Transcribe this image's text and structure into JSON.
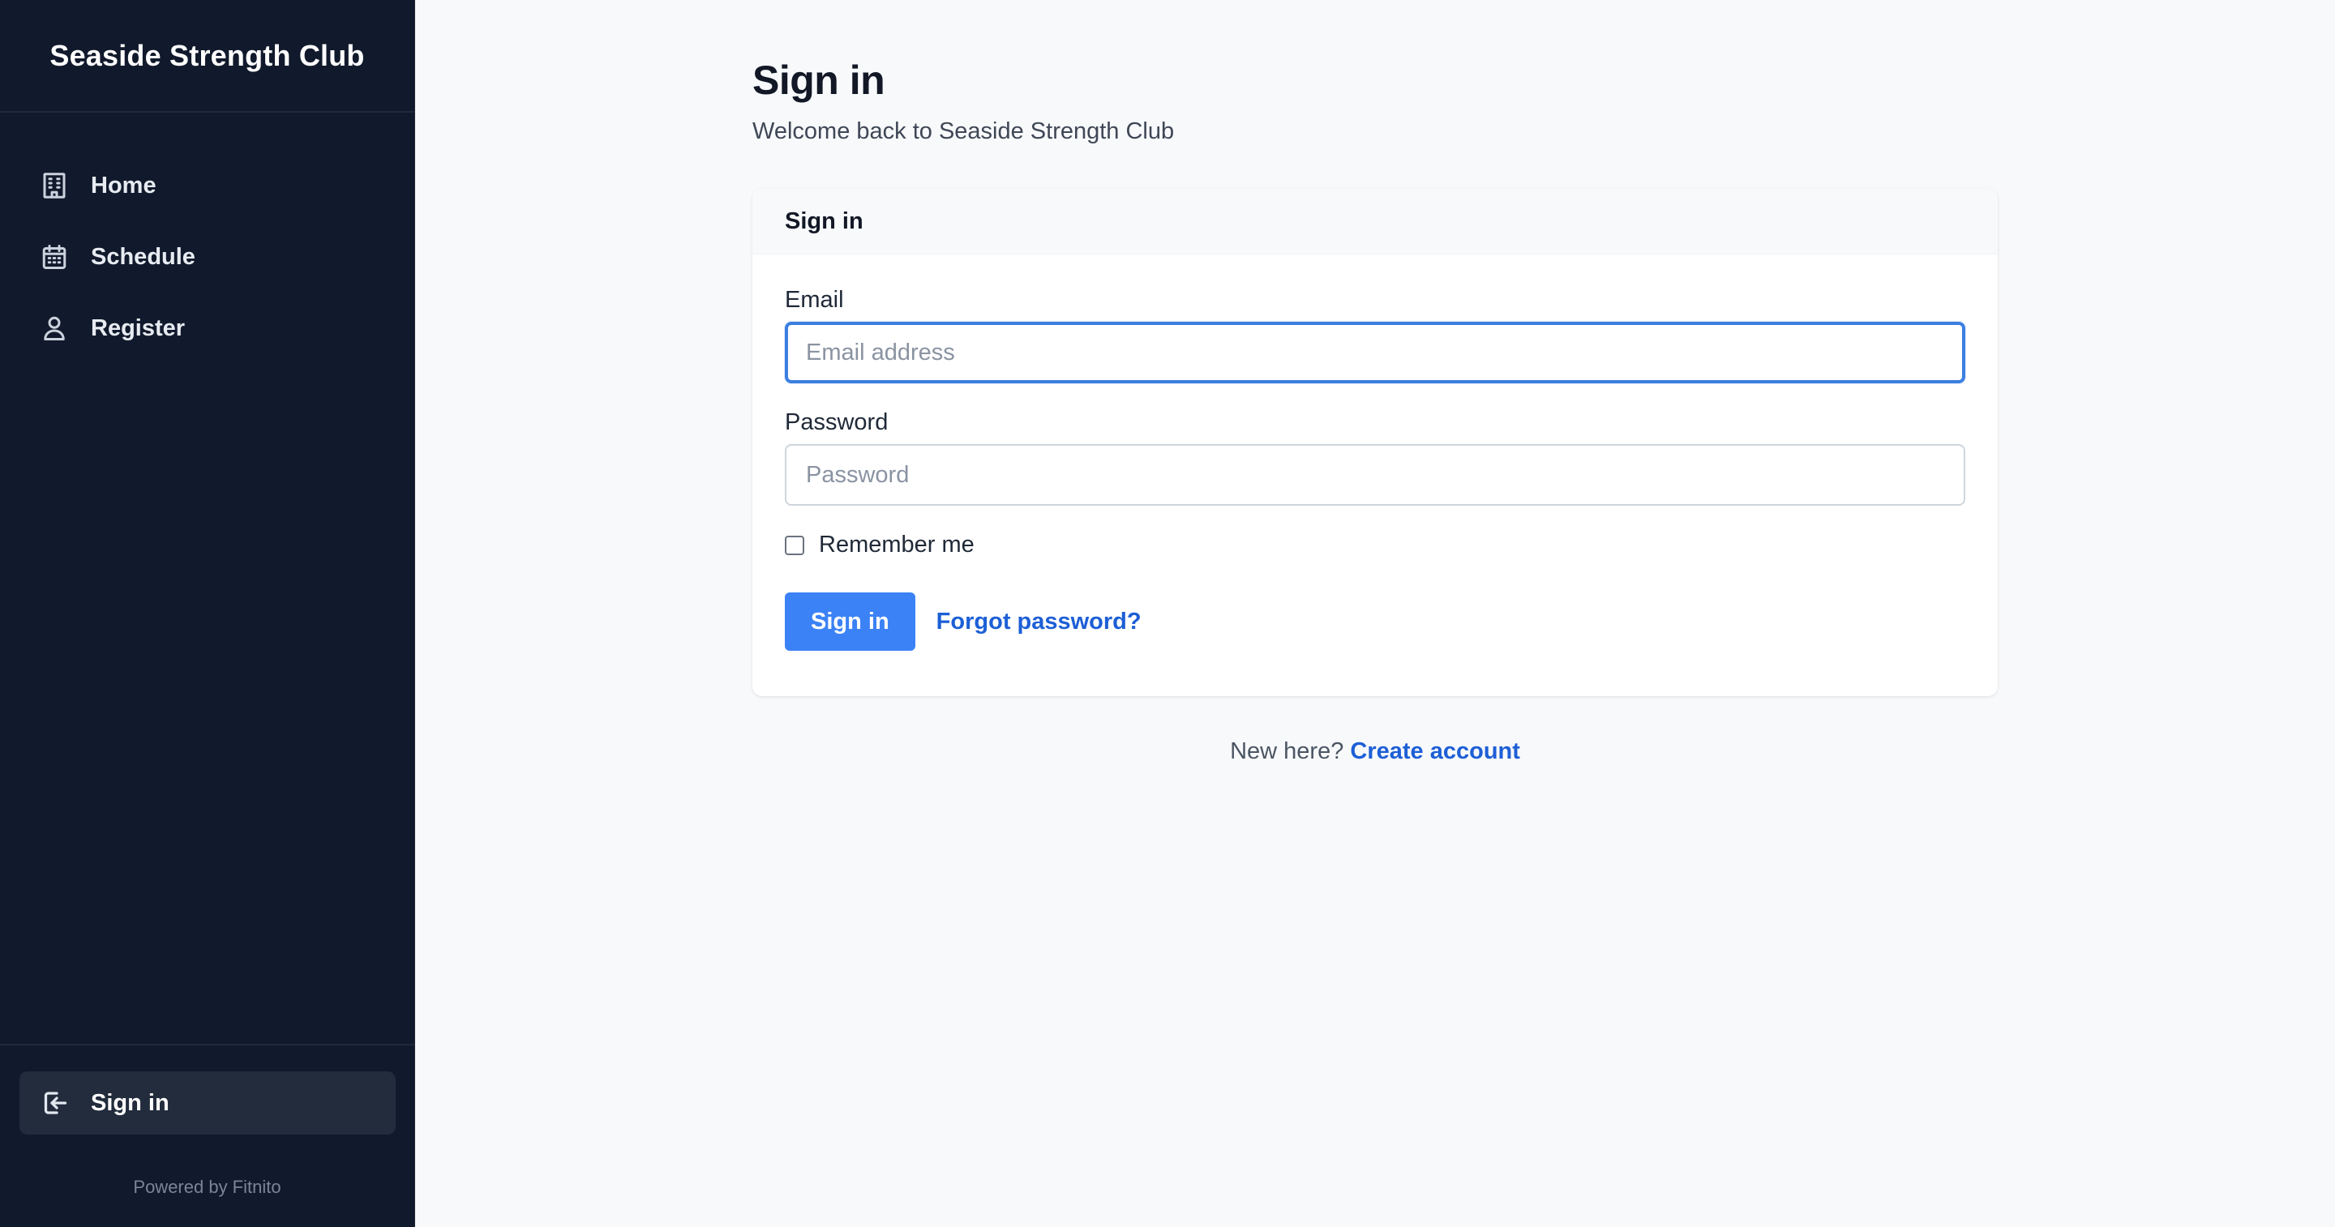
{
  "brand": {
    "title": "Seaside Strength Club"
  },
  "sidebar": {
    "items": [
      {
        "label": "Home",
        "icon": "building-icon"
      },
      {
        "label": "Schedule",
        "icon": "calendar-icon"
      },
      {
        "label": "Register",
        "icon": "user-icon"
      }
    ],
    "footer": {
      "signin_label": "Sign in",
      "signin_icon": "sign-in-icon",
      "powered_by": "Powered by Fitnito"
    }
  },
  "page": {
    "title": "Sign in",
    "subtitle": "Welcome back to Seaside Strength Club"
  },
  "card": {
    "header": "Sign in",
    "email": {
      "label": "Email",
      "placeholder": "Email address",
      "value": ""
    },
    "password": {
      "label": "Password",
      "placeholder": "Password",
      "value": ""
    },
    "remember_label": "Remember me",
    "remember_checked": false,
    "submit_label": "Sign in",
    "forgot_label": "Forgot password?"
  },
  "footer": {
    "prompt": "New here?",
    "create_label": "Create account"
  },
  "colors": {
    "sidebar_bg": "#111a2c",
    "accent": "#3b82f6",
    "link": "#1d5fd6",
    "focus_ring": "#3b7fe0"
  }
}
